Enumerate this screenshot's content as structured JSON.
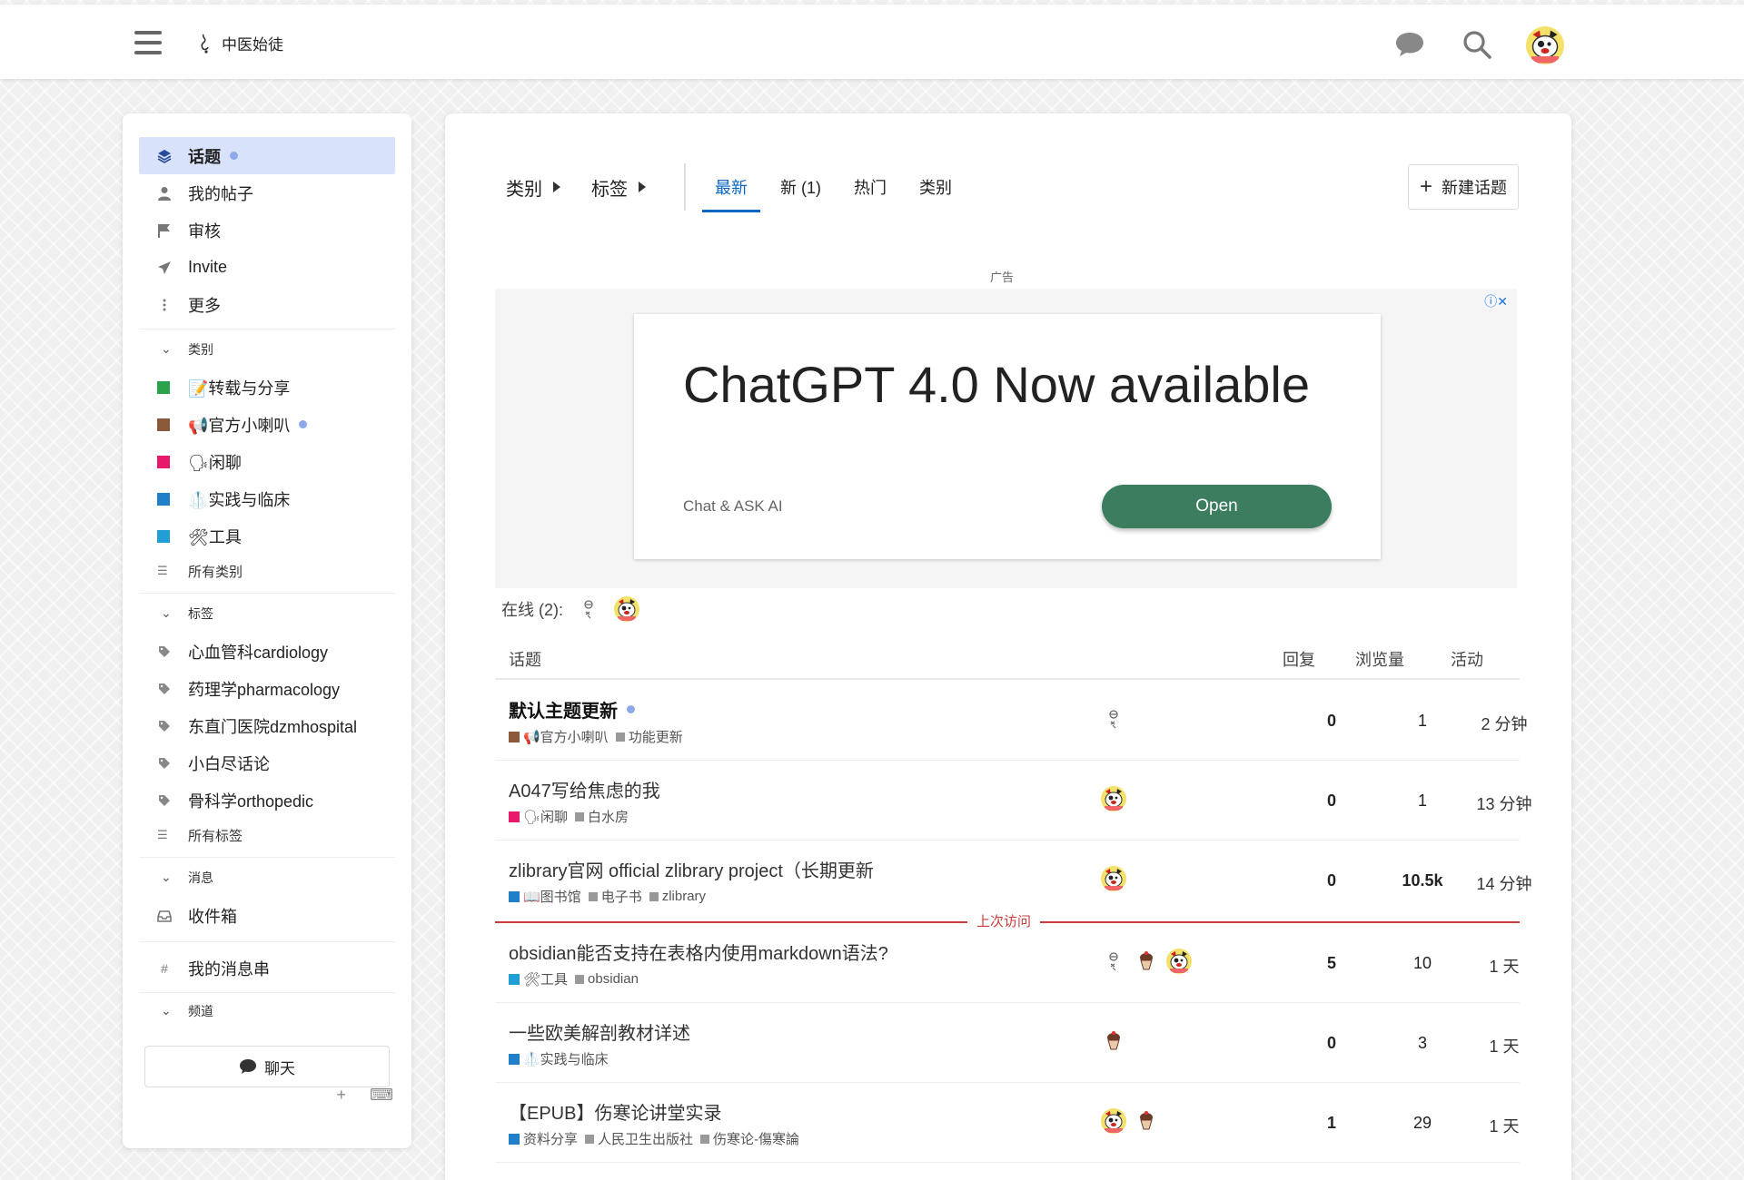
{
  "header": {
    "site_name": "中医始徒"
  },
  "sidebar": {
    "items": [
      {
        "label": "话题",
        "icon": "layers-icon",
        "active": true,
        "dot": true
      },
      {
        "label": "我的帖子",
        "icon": "user-icon"
      },
      {
        "label": "审核",
        "icon": "flag-icon"
      },
      {
        "label": "Invite",
        "icon": "paper-plane-icon"
      },
      {
        "label": "更多",
        "icon": "ellipsis-vertical-icon"
      }
    ],
    "categories_header": "类别",
    "categories": [
      {
        "label": "📝转载与分享",
        "color": "#2aa34a"
      },
      {
        "label": "📢官方小喇叭",
        "color": "#8a5a3a",
        "dot": true
      },
      {
        "label": "🗣闲聊",
        "color": "#e8196b"
      },
      {
        "label": "🥼实践与临床",
        "color": "#1f80c9"
      },
      {
        "label": "🛠工具",
        "color": "#1f9fd6"
      }
    ],
    "all_categories": "所有类别",
    "tags_header": "标签",
    "tags": [
      {
        "label": "心血管科cardiology"
      },
      {
        "label": "药理学pharmacology"
      },
      {
        "label": "东直门医院dzmhospital"
      },
      {
        "label": "小白尽话论"
      },
      {
        "label": "骨科学orthopedic"
      }
    ],
    "all_tags": "所有标签",
    "messages_header": "消息",
    "inbox": "收件箱",
    "my_threads": "我的消息串",
    "channels_header": "频道",
    "chat_button": "聊天"
  },
  "nav": {
    "categories_drop": "类别",
    "tags_drop": "标签",
    "tabs": [
      {
        "label": "最新",
        "active": true
      },
      {
        "label": "新 (1)"
      },
      {
        "label": "热门"
      },
      {
        "label": "类别"
      }
    ],
    "new_topic": "新建话题"
  },
  "ad": {
    "label": "广告",
    "title": "ChatGPT 4.0 Now available",
    "subtitle": "Chat & ASK AI",
    "button": "Open",
    "corner": "ⓘ✕"
  },
  "online": {
    "label": "在线 (2):"
  },
  "table": {
    "headers": {
      "topic": "话题",
      "replies": "回复",
      "views": "浏览量",
      "activity": "活动"
    },
    "last_visit": "上次访问",
    "rows": [
      {
        "title": "默认主题更新",
        "unread": true,
        "category": "📢官方小喇叭",
        "category_color": "#8a5a3a",
        "tags": [
          "功能更新"
        ],
        "posters": [
          "doodle-avatar"
        ],
        "replies": "0",
        "views": "1",
        "activity": "2 分钟"
      },
      {
        "title": "A047写给焦虑的我",
        "category": "🗣闲聊",
        "category_color": "#e8196b",
        "tags": [
          "白水房"
        ],
        "posters": [
          "dog-avatar"
        ],
        "replies": "0",
        "views": "1",
        "activity": "13 分钟"
      },
      {
        "title": "zlibrary官网 official zlibrary project（长期更新",
        "category": "📖图书馆",
        "category_color": "#1f80c9",
        "tags": [
          "电子书",
          "zlibrary"
        ],
        "posters": [
          "dog-avatar"
        ],
        "replies": "0",
        "views": "10.5k",
        "views_bold": true,
        "activity": "14 分钟"
      },
      {
        "title": "obsidian能否支持在表格内使用markdown语法?",
        "category": "🛠工具",
        "category_color": "#1f9fd6",
        "tags": [
          "obsidian"
        ],
        "posters": [
          "doodle-avatar",
          "cake-avatar",
          "dog-avatar"
        ],
        "replies": "5",
        "views": "10",
        "activity": "1 天"
      },
      {
        "title": "一些欧美解剖教材详述",
        "category": "🥼实践与临床",
        "category_color": "#1f80c9",
        "tags": [],
        "posters": [
          "cake-avatar"
        ],
        "replies": "0",
        "views": "3",
        "activity": "1 天"
      },
      {
        "title": "【EPUB】伤寒论讲堂实录",
        "category": "资料分享",
        "category_color": "#1f80c9",
        "tags": [
          "人民卫生出版社",
          "伤寒论-傷寒論"
        ],
        "posters": [
          "dog-avatar",
          "cake-avatar"
        ],
        "replies": "1",
        "views": "29",
        "activity": "1 天"
      }
    ]
  }
}
